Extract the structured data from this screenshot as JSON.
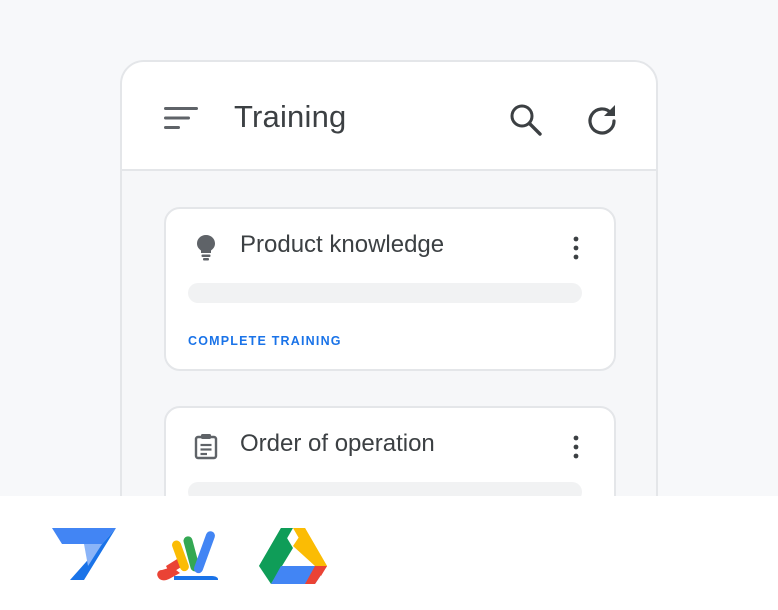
{
  "app": {
    "title": "Training"
  },
  "colors": {
    "accent": "#1a73e8",
    "text": "#3c4043",
    "border": "#e4e6e9"
  },
  "icons": {
    "menu": "sort-menu-icon",
    "search": "search-icon",
    "refresh": "refresh-icon",
    "more": "more-vert-icon"
  },
  "cards": [
    {
      "icon": "lightbulb-icon",
      "title": "Product knowledge",
      "action": "COMPLETE TRAINING"
    },
    {
      "icon": "clipboard-icon",
      "title": "Order of operation"
    }
  ],
  "footer_logos": [
    "appsheet-logo",
    "apps-script-logo",
    "google-drive-logo"
  ]
}
